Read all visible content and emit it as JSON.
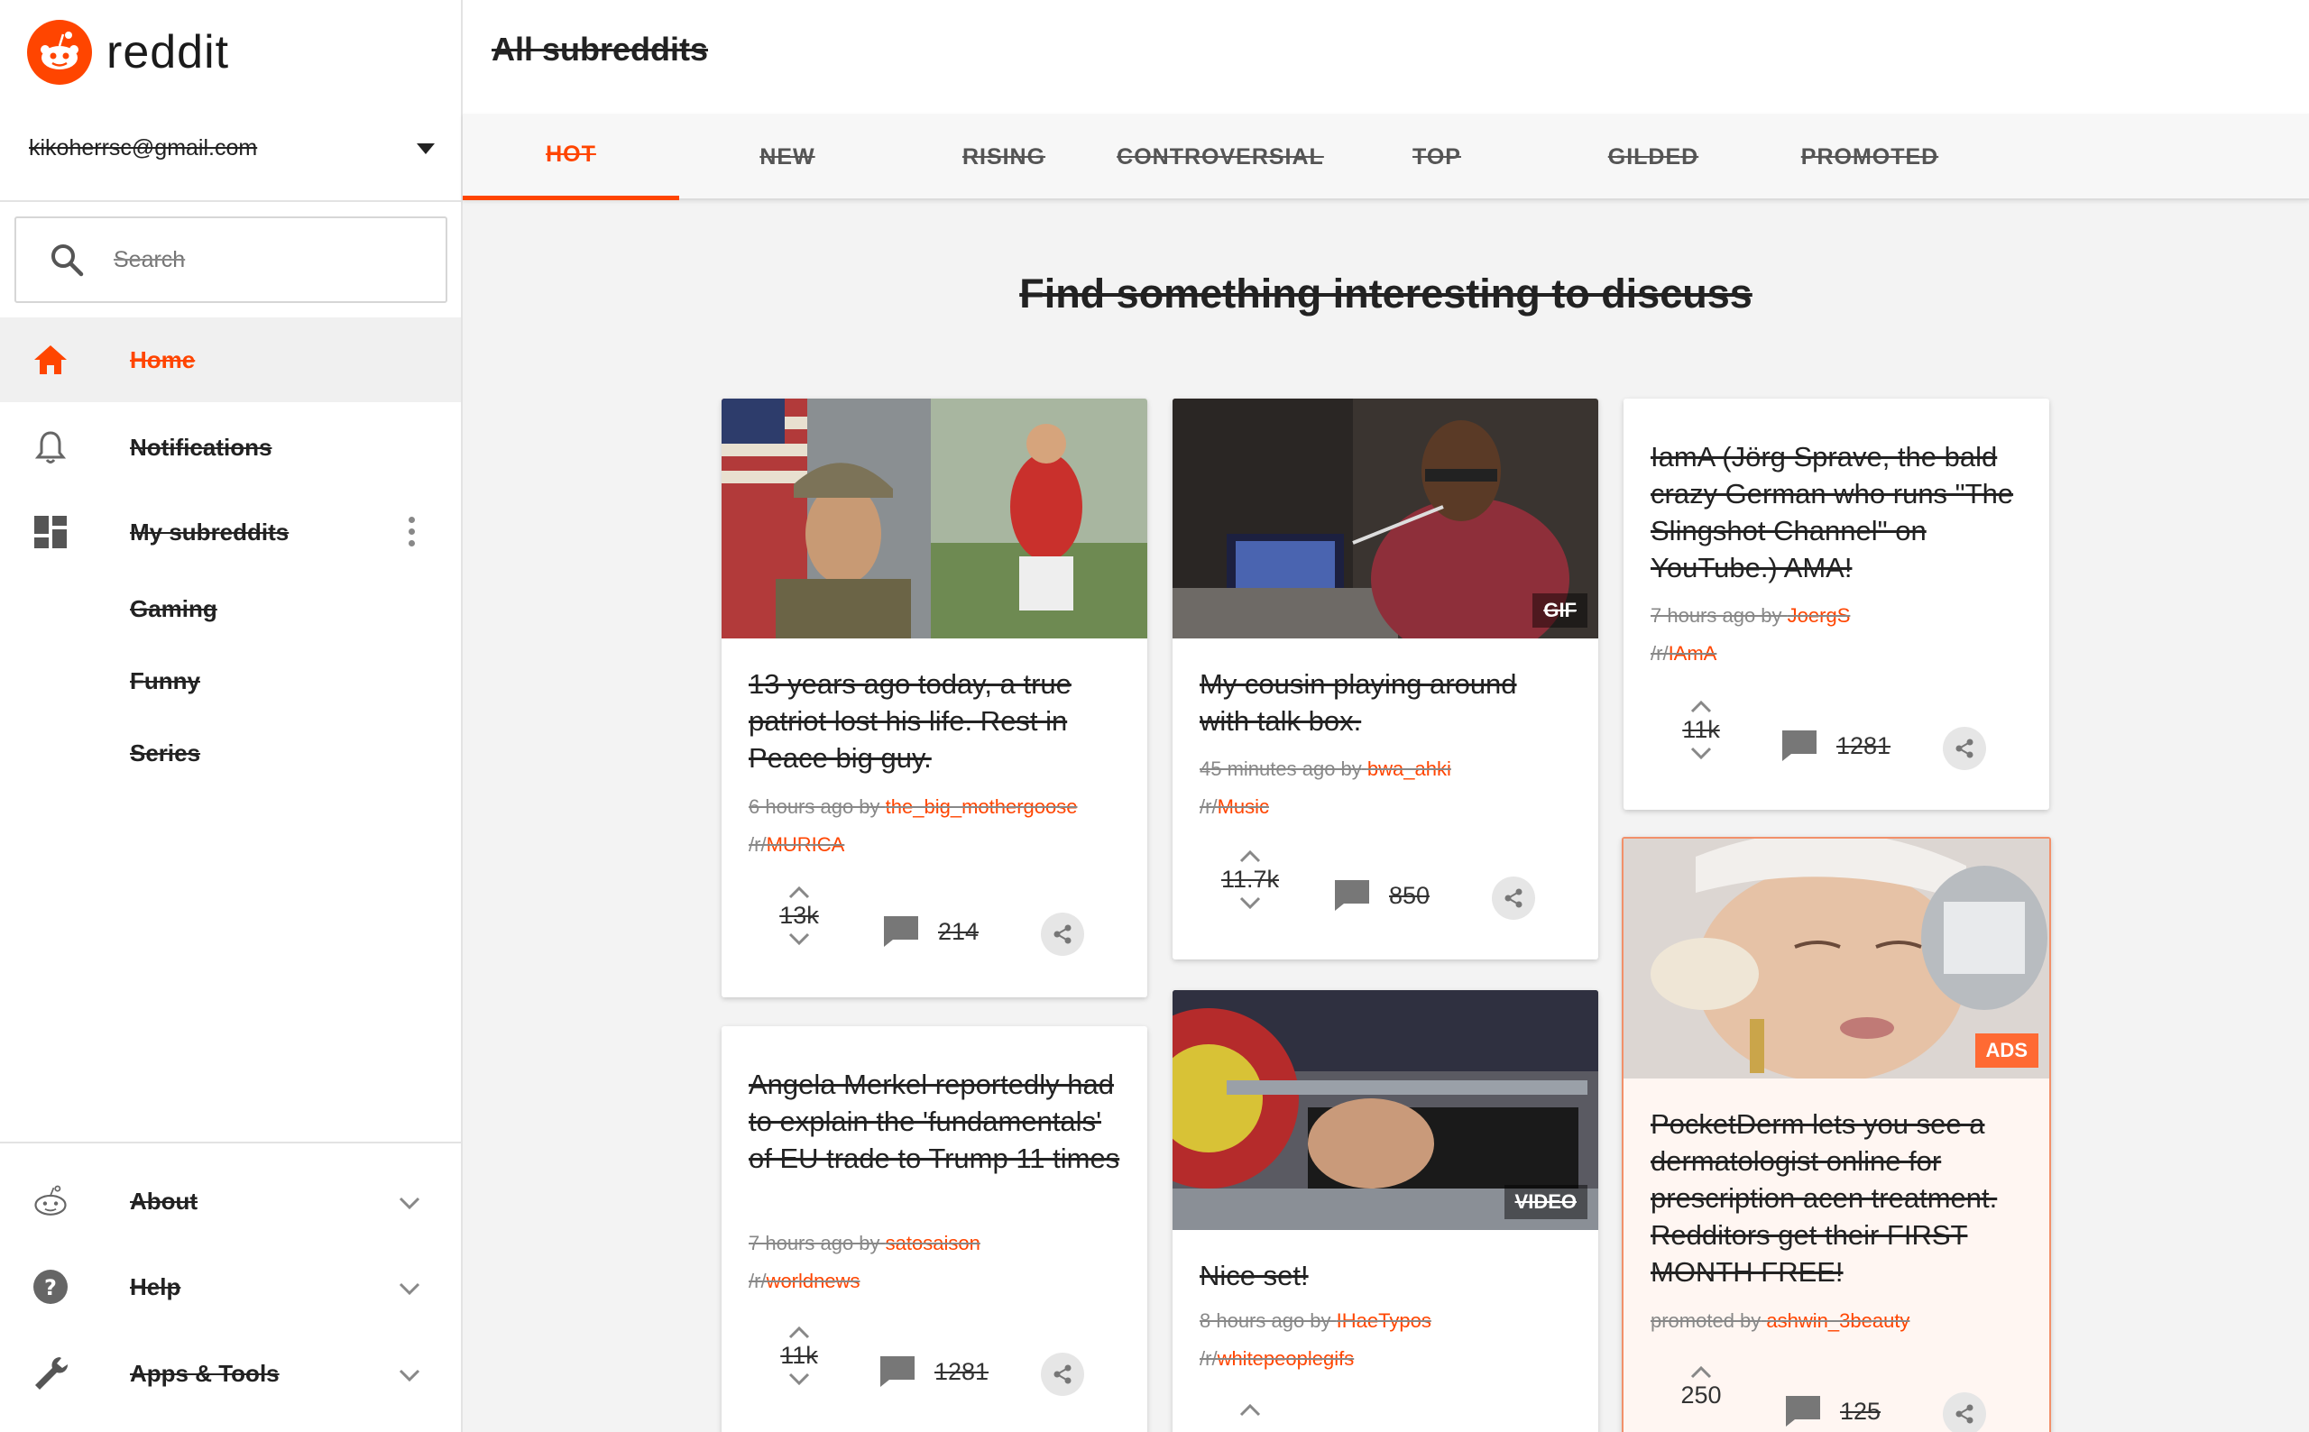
{
  "brand": {
    "name": "reddit",
    "accent": "#ff4500"
  },
  "account": {
    "email": "kikoherrsc@gmail.com"
  },
  "search": {
    "placeholder": "Search"
  },
  "nav": {
    "home": "Home",
    "notifications": "Notifications",
    "my_subreddits": "My subreddits",
    "subs": [
      "Gaming",
      "Funny",
      "Series"
    ],
    "about": "About",
    "help": "Help",
    "apps_tools": "Apps & Tools"
  },
  "header": {
    "title": "All subreddits"
  },
  "tabs": [
    "HOT",
    "NEW",
    "RISING",
    "CONTROVERSIAL",
    "TOP",
    "GILDED",
    "PROMOTED"
  ],
  "headline": "Find something interesting to discuss",
  "posts": [
    {
      "title": "13 years ago today, a true patriot lost his life. Rest in Peace big guy.",
      "age": "6 hours ago by",
      "user": "the_big_mothergoose",
      "sub_prefix": "/r/",
      "sub": "MURICA",
      "votes": "13k",
      "comments": "214"
    },
    {
      "title": "Angela Merkel reportedly had to explain the 'fundamentals' of EU trade to Trump 11 times",
      "age": "7 hours ago by",
      "user": "satosaison",
      "sub_prefix": "/r/",
      "sub": "worldnews",
      "votes": "11k",
      "comments": "1281"
    },
    {
      "title": "My cousin playing around with talk box.",
      "badge": "GIF",
      "age": "45 minutes ago by",
      "user": "bwa_ahki",
      "sub_prefix": "/r/",
      "sub": "Music",
      "votes": "11.7k",
      "comments": "850"
    },
    {
      "title": "Nice set!",
      "badge": "VIDEO",
      "age": "8 hours ago by",
      "user": "IHaeTypos",
      "sub_prefix": "/r/",
      "sub": "whitepeoplegifs"
    },
    {
      "title": "IamA (Jörg Sprave, the bald crazy German who runs \"The Slingshot Channel\" on YouTube.) AMA!",
      "age": "7 hours ago by",
      "user": "JoergS",
      "sub_prefix": "/r/",
      "sub": "IAmA",
      "votes": "11k",
      "comments": "1281"
    },
    {
      "title": "PocketDerm lets you see a dermatologist online for prescription acen treatment. Redditors get their FIRST MONTH FREE!",
      "badge": "ADS",
      "age": "promoted by",
      "user": "ashwin_3beauty",
      "votes": "250",
      "comments": "125"
    }
  ]
}
